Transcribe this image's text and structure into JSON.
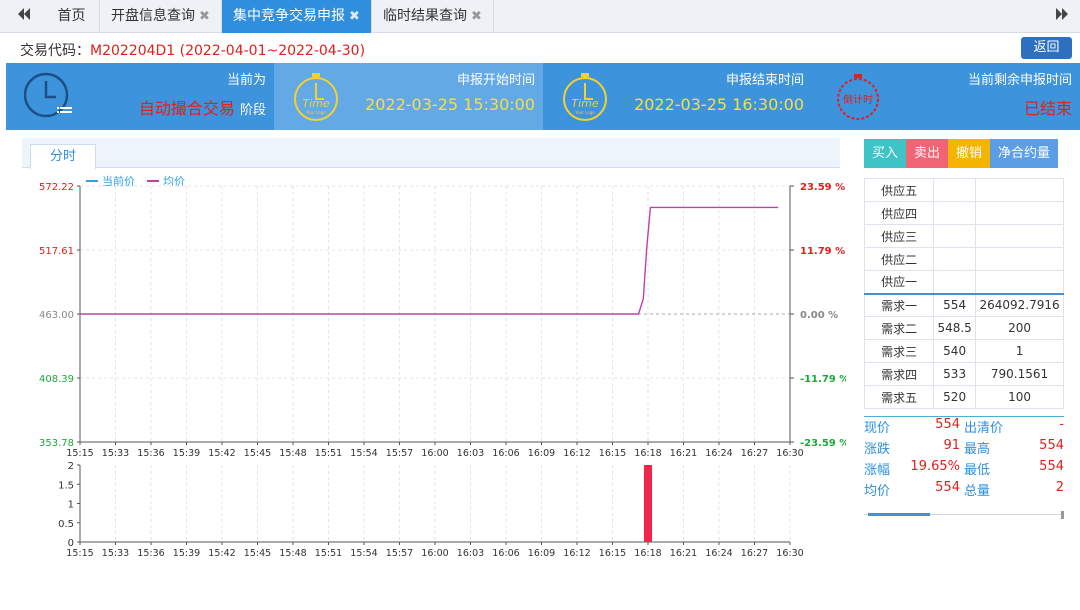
{
  "tabs": [
    {
      "label": "首页",
      "closable": false,
      "active": false
    },
    {
      "label": "开盘信息查询",
      "closable": true,
      "active": false
    },
    {
      "label": "集中竞争交易申报",
      "closable": true,
      "active": true
    },
    {
      "label": "临时结果查询",
      "closable": true,
      "active": false
    }
  ],
  "nav": {
    "prev_icon": "double-left-arrow",
    "next_icon": "double-right-arrow"
  },
  "close_glyph": "✖",
  "trade": {
    "code_label": "交易代码：",
    "code_value": "M202204D1 (2022-04-01~2022-04-30)",
    "back_label": "返回"
  },
  "info": {
    "phase_title": "当前为",
    "phase_value": "自动撮合交易",
    "phase_suffix": "阶段",
    "start_title": "申报开始时间",
    "start_value": "2022-03-25 15:30:00",
    "end_title": "申报结束时间",
    "end_value": "2022-03-25 16:30:00",
    "remain_title": "当前剩余申报时间",
    "remain_value": "已结束",
    "gauge_word": "Time",
    "gauge_sub": "Your Logo",
    "countdown_word": "倒计时"
  },
  "chart_tab": "分时",
  "actions": {
    "buy": "买入",
    "sell": "卖出",
    "cancel": "撤销",
    "net": "净合约量"
  },
  "colors": {
    "up": "#e0201c",
    "down": "#1ca83a",
    "price_line": "#2fa0e6",
    "avg_line": "#c040a8",
    "accent": "#2f8fdc"
  },
  "book": {
    "supply": [
      {
        "label": "供应五",
        "price": "",
        "qty": ""
      },
      {
        "label": "供应四",
        "price": "",
        "qty": ""
      },
      {
        "label": "供应三",
        "price": "",
        "qty": ""
      },
      {
        "label": "供应二",
        "price": "",
        "qty": ""
      },
      {
        "label": "供应一",
        "price": "",
        "qty": ""
      }
    ],
    "demand": [
      {
        "label": "需求一",
        "price": "554",
        "qty": "264092.7916"
      },
      {
        "label": "需求二",
        "price": "548.5",
        "qty": "200"
      },
      {
        "label": "需求三",
        "price": "540",
        "qty": "1"
      },
      {
        "label": "需求四",
        "price": "533",
        "qty": "790.1561"
      },
      {
        "label": "需求五",
        "price": "520",
        "qty": "100"
      }
    ]
  },
  "stats": [
    {
      "k1": "现价",
      "v1": "554",
      "k2": "出清价",
      "v2": "-"
    },
    {
      "k1": "涨跌",
      "v1": "91",
      "k2": "最高",
      "v2": "554"
    },
    {
      "k1": "涨幅",
      "v1": "19.65%",
      "k2": "最低",
      "v2": "554"
    },
    {
      "k1": "均价",
      "v1": "554",
      "k2": "总量",
      "v2": "2"
    }
  ],
  "chart_data": {
    "type": "line",
    "legend": [
      "当前价",
      "均价"
    ],
    "legend_position": "top-left",
    "x_ticks": [
      "15:15",
      "15:33",
      "15:36",
      "15:39",
      "15:42",
      "15:45",
      "15:48",
      "15:51",
      "15:54",
      "15:57",
      "16:00",
      "16:03",
      "16:06",
      "16:09",
      "16:12",
      "16:15",
      "16:18",
      "16:21",
      "16:24",
      "16:27",
      "16:30"
    ],
    "price_axis": {
      "min": 353.78,
      "max": 572.22,
      "ticks": [
        "572.22",
        "517.61",
        "463.00",
        "408.39",
        "353.78"
      ],
      "base": 463.0
    },
    "pct_axis": {
      "ticks": [
        "23.59 %",
        "11.79 %",
        "0.00 %",
        "-11.79 %",
        "-23.59 %"
      ]
    },
    "series": [
      {
        "name": "均价",
        "points": [
          [
            "15:15",
            463.0
          ],
          [
            "16:17.2",
            463.0
          ],
          [
            "16:17.6",
            476.0
          ],
          [
            "16:17.9",
            520.0
          ],
          [
            "16:18.2",
            554.0
          ],
          [
            "16:29",
            554.0
          ]
        ]
      }
    ],
    "volume": {
      "ymin": 0,
      "ymax": 2,
      "y_ticks": [
        "2",
        "1.5",
        "1",
        "0.5",
        "0"
      ],
      "bars": [
        {
          "x": "16:18",
          "value": 2
        }
      ]
    },
    "grid": true
  }
}
